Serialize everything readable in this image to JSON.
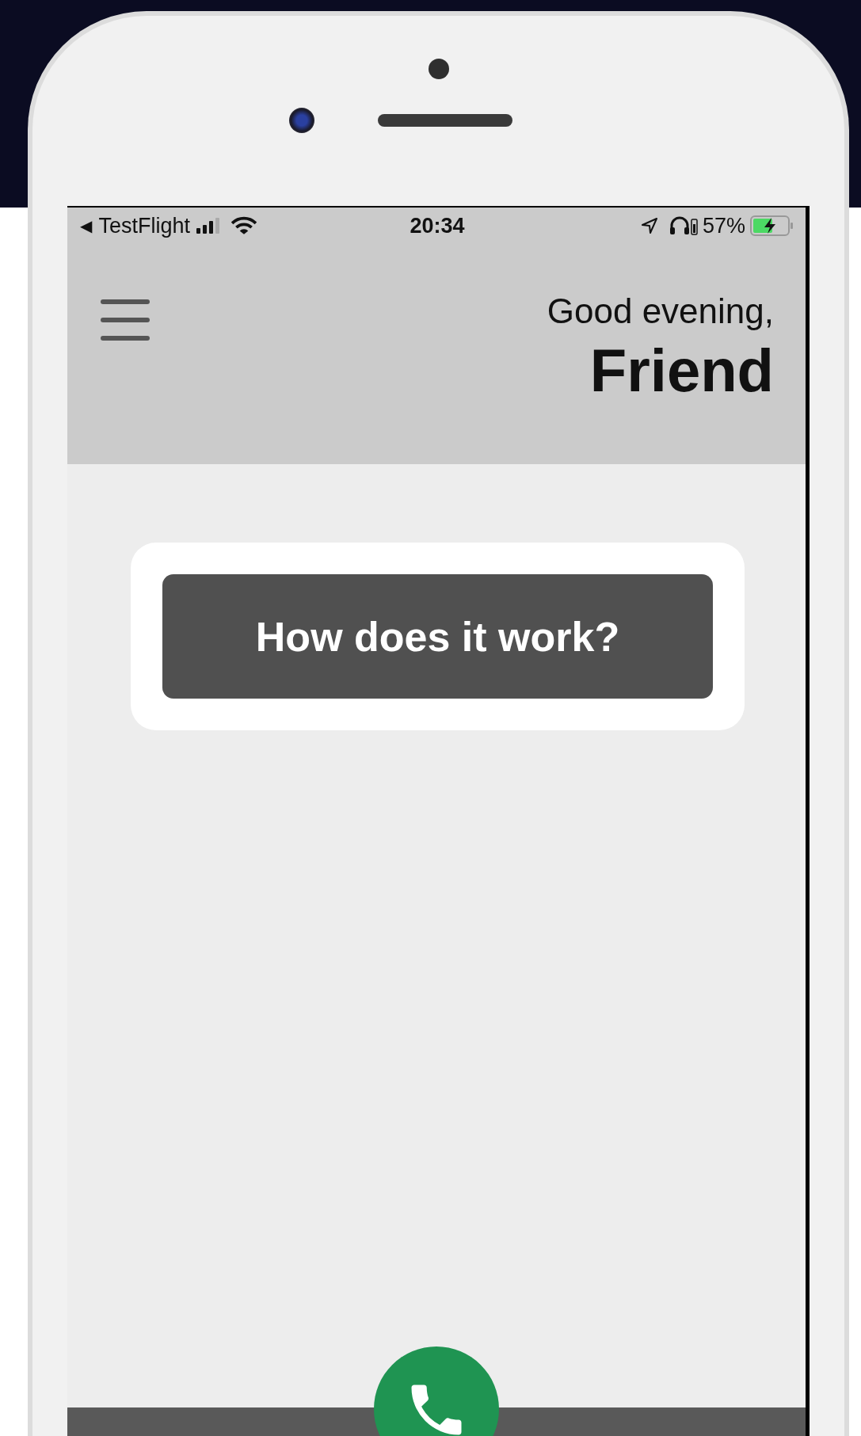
{
  "status_bar": {
    "back_arrow": "◀",
    "app": "TestFlight",
    "time": "20:34",
    "battery_percent": "57%"
  },
  "header": {
    "greeting": "Good evening,",
    "name": "Friend"
  },
  "card": {
    "button": "How does it work?"
  }
}
